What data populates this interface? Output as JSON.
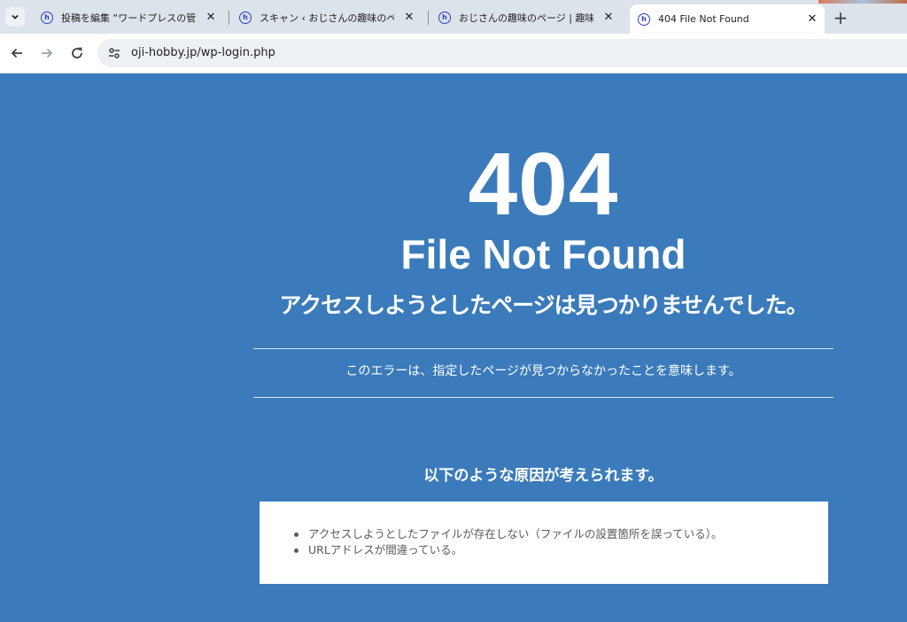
{
  "browser": {
    "tabs": [
      {
        "title": "投稿を編集 “ワードプレスの管理画面",
        "active": false
      },
      {
        "title": "スキャン ‹ おじさんの趣味のページ —",
        "active": false
      },
      {
        "title": "おじさんの趣味のページ | 趣味でやっ",
        "active": false
      },
      {
        "title": "404 File Not Found",
        "active": true
      }
    ],
    "favicon_glyph": "h",
    "close_glyph": "✕",
    "new_tab_glyph": "+",
    "url": "oji-hobby.jp/wp-login.php"
  },
  "page": {
    "code": "404",
    "heading": "File Not Found",
    "message": "アクセスしようとしたページは見つかりませんでした。",
    "description": "このエラーは、指定したページが見つからなかったことを意味します。",
    "reasons_heading": "以下のような原因が考えられます。",
    "reasons": [
      "アクセスしようとしたファイルが存在しない（ファイルの設置箇所を誤っている）。",
      "URLアドレスが間違っている。"
    ]
  },
  "colors": {
    "background": "#3b7bbb",
    "text": "#ffffff",
    "box": "#ffffff",
    "box_text": "#5a5a5a"
  },
  "icons": {
    "tab_search": "chevron-down-icon",
    "back": "arrow-left-icon",
    "forward": "arrow-right-icon",
    "reload": "reload-icon",
    "site_info": "site-settings-icon",
    "favicon": "site-favicon-icon"
  }
}
